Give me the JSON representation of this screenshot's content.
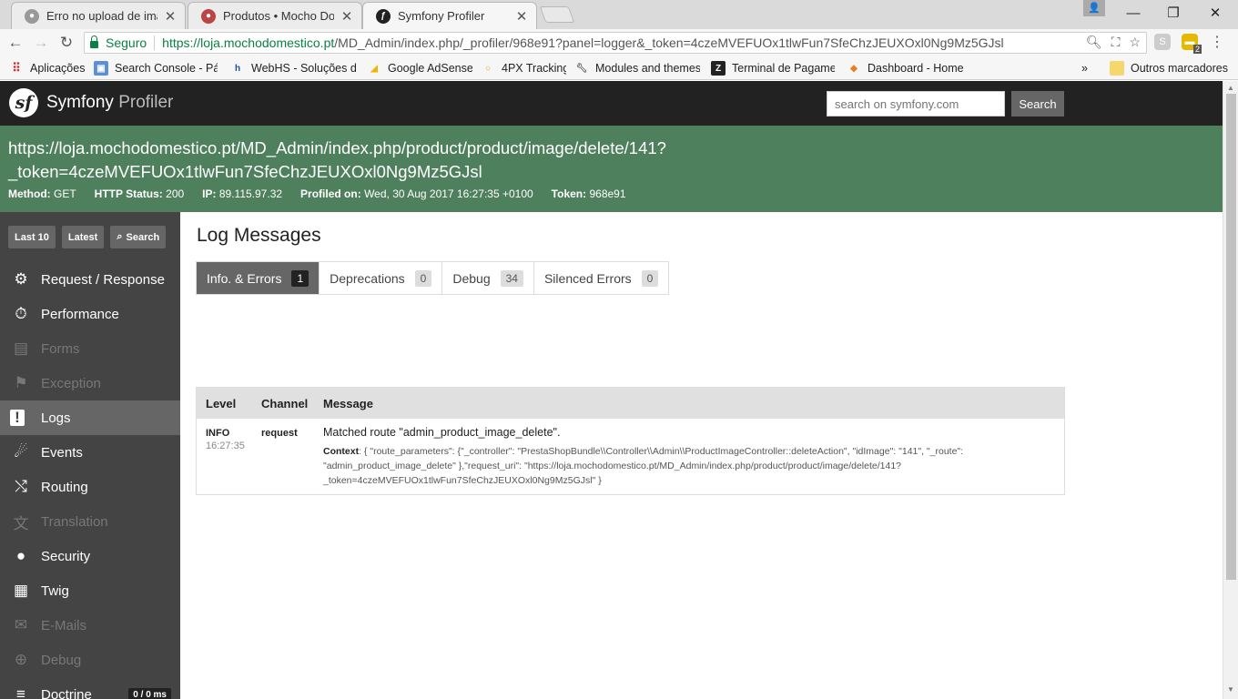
{
  "browser": {
    "tabs": [
      {
        "title": "Erro no upload de imagem",
        "close": "✕"
      },
      {
        "title": "Produtos • Mocho Doméstico",
        "close": "✕"
      },
      {
        "title": "Symfony Profiler",
        "close": "✕"
      }
    ],
    "window_controls": {
      "minimize": "—",
      "maximize": "❐",
      "close": "✕"
    },
    "nav": {
      "back": "←",
      "forward": "→",
      "reload": "↻"
    },
    "address": {
      "secure_label": "Seguro",
      "url_main": "https://loja.mochodomestico.pt",
      "url_rest": "/MD_Admin/index.php/_profiler/968e91?panel=logger&_token=4czeMVEFUOx1tlwFun7SfeChzJEUXOxl0Ng9Mz5GJsl"
    },
    "extension_badge": "2",
    "bookmarks": [
      {
        "label": "Aplicações",
        "icon": "apps-icon"
      },
      {
        "label": "Search Console - Pág",
        "icon": "search-console-icon"
      },
      {
        "label": "WebHS - Soluções de",
        "icon": "webhs-icon"
      },
      {
        "label": "Google AdSense",
        "icon": "adsense-icon"
      },
      {
        "label": "4PX Tracking",
        "icon": "4px-icon"
      },
      {
        "label": "Modules and themes",
        "icon": "wrench-icon"
      },
      {
        "label": "Terminal de Pagamen",
        "icon": "terminal-icon"
      },
      {
        "label": "Dashboard - Home",
        "icon": "dashboard-icon"
      },
      {
        "label": "Outros marcadores",
        "icon": "folder-icon"
      }
    ],
    "bookmarks_more": "»"
  },
  "profiler": {
    "logo": "sf",
    "title_brand": "Symfony",
    "title_suffix": "Profiler",
    "search_placeholder": "search on symfony.com",
    "search_button": "Search",
    "request_url_line1": "https://loja.mochodomestico.pt/MD_Admin/index.php/product/product/image/delete/141?",
    "request_url_line2": "_token=4czeMVEFUOx1tlwFun7SfeChzJEUXOxl0Ng9Mz5GJsl",
    "meta": {
      "method_label": "Method:",
      "method": "GET",
      "status_label": "HTTP Status:",
      "status": "200",
      "ip_label": "IP:",
      "ip": "89.115.97.32",
      "profiled_label": "Profiled on:",
      "profiled": "Wed, 30 Aug 2017 16:27:35 +0100",
      "token_label": "Token:",
      "token": "968e91"
    },
    "sidebar_buttons": {
      "last10": "Last 10",
      "latest": "Latest",
      "search": "Search"
    },
    "menu": [
      {
        "label": "Request / Response",
        "icon": "⚙",
        "enabled": true
      },
      {
        "label": "Performance",
        "icon": "⏱",
        "enabled": true
      },
      {
        "label": "Forms",
        "icon": "▤",
        "enabled": false
      },
      {
        "label": "Exception",
        "icon": "⚑",
        "enabled": false
      },
      {
        "label": "Logs",
        "icon": "!",
        "enabled": true
      },
      {
        "label": "Events",
        "icon": "☄",
        "enabled": true
      },
      {
        "label": "Routing",
        "icon": "⤭",
        "enabled": true
      },
      {
        "label": "Translation",
        "icon": "文",
        "enabled": false
      },
      {
        "label": "Security",
        "icon": "●",
        "enabled": true
      },
      {
        "label": "Twig",
        "icon": "▦",
        "enabled": true
      },
      {
        "label": "E-Mails",
        "icon": "✉",
        "enabled": false
      },
      {
        "label": "Debug",
        "icon": "⊕",
        "enabled": false
      },
      {
        "label": "Doctrine",
        "icon": "≡",
        "enabled": true,
        "badge": "0 / 0 ms"
      }
    ],
    "panel_title": "Log Messages",
    "log_tabs": [
      {
        "label": "Info. & Errors",
        "count": "1"
      },
      {
        "label": "Deprecations",
        "count": "0"
      },
      {
        "label": "Debug",
        "count": "34"
      },
      {
        "label": "Silenced Errors",
        "count": "0"
      }
    ],
    "table_headers": {
      "level": "Level",
      "channel": "Channel",
      "message": "Message"
    },
    "log_entries": [
      {
        "level": "INFO",
        "time": "16:27:35",
        "channel": "request",
        "message": "Matched route \"admin_product_image_delete\".",
        "context_label": "Context",
        "context_line1": ": { \"route_parameters\": {\"_controller\": \"PrestaShopBundle\\\\Controller\\\\Admin\\\\ProductImageController::deleteAction\", \"idImage\": \"141\", \"_route\":",
        "context_line2": "\"admin_product_image_delete\" },\"request_uri\": \"https://loja.mochodomestico.pt/MD_Admin/index.php/product/product/image/delete/141?",
        "context_line3": "_token=4czeMVEFUOx1tlwFun7SfeChzJEUXOxl0Ng9Mz5GJsl\" }"
      }
    ]
  }
}
